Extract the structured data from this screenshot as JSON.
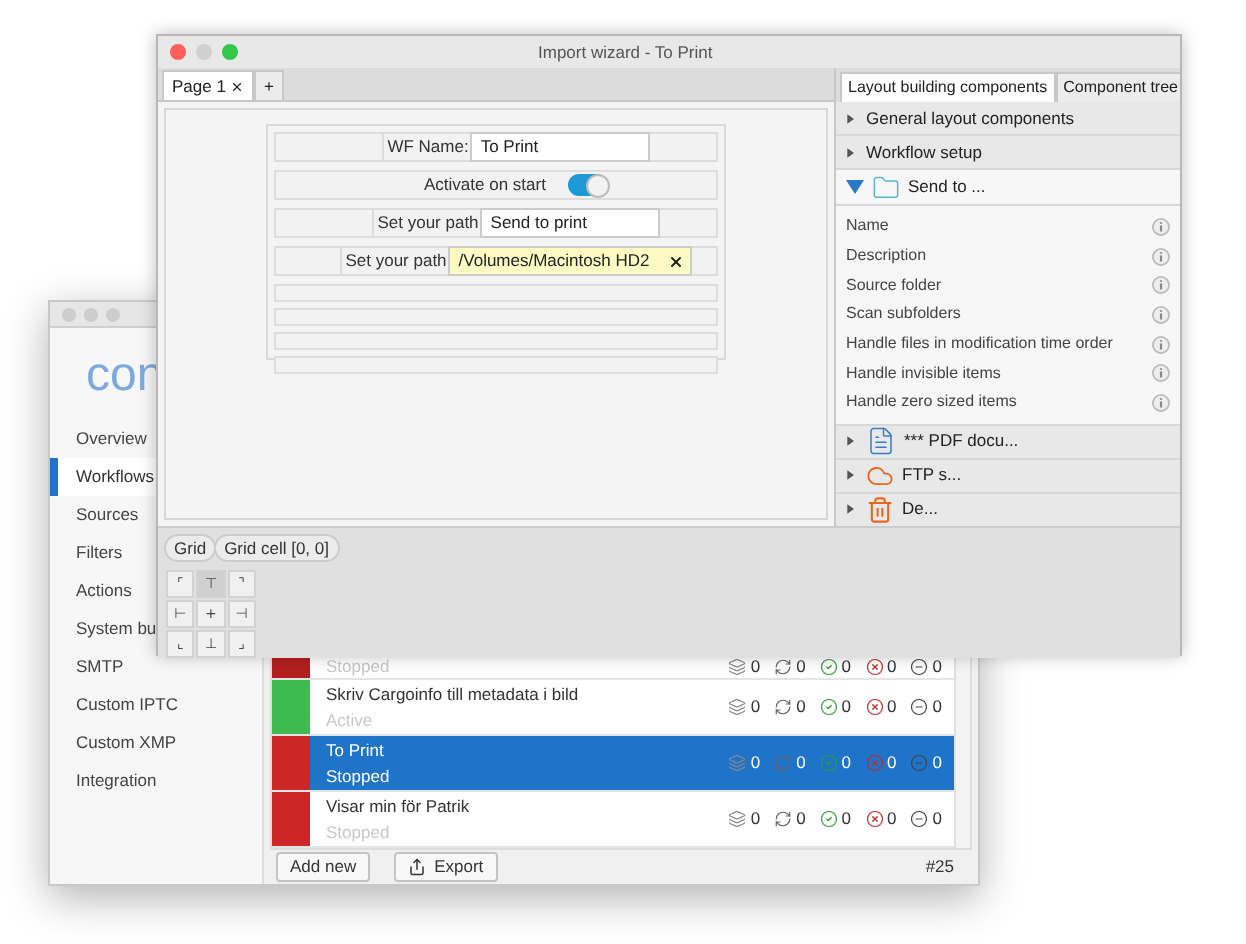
{
  "back_window": {
    "logo": "con",
    "sidebar": {
      "items": [
        {
          "label": "Overview",
          "selected": false
        },
        {
          "label": "Workflows",
          "selected": true
        },
        {
          "label": "Sources",
          "selected": false
        },
        {
          "label": "Filters",
          "selected": false
        },
        {
          "label": "Actions",
          "selected": false
        },
        {
          "label": "System bu",
          "selected": false
        },
        {
          "label": "SMTP",
          "selected": false
        },
        {
          "label": "Custom IPTC",
          "selected": false
        },
        {
          "label": "Custom XMP",
          "selected": false
        },
        {
          "label": "Integration",
          "selected": false
        }
      ]
    },
    "workflows": [
      {
        "status": "Stopped",
        "color": "#b42020",
        "selected": false,
        "counts": [
          "0",
          "0",
          "0",
          "0",
          "0"
        ]
      },
      {
        "name": "Skriv Cargoinfo till metadata i bild",
        "status": "Active",
        "color": "#3fba4f",
        "selected": false,
        "counts": [
          "0",
          "0",
          "0",
          "0",
          "0"
        ]
      },
      {
        "name": "To Print",
        "status": "Stopped",
        "color": "#cc2626",
        "selected": true,
        "counts": [
          "0",
          "0",
          "0",
          "0",
          "0"
        ]
      },
      {
        "name": "Visar min för Patrik",
        "status": "Stopped",
        "color": "#cc2626",
        "selected": false,
        "counts": [
          "0",
          "0",
          "0",
          "0",
          "0"
        ]
      }
    ],
    "buttons": [
      {
        "label": "Add new",
        "kind": "plain"
      },
      {
        "label": "Export",
        "kind": "export"
      }
    ],
    "total": "#25"
  },
  "wizard": {
    "title": "Import wizard - To Print",
    "tabs": [
      {
        "label": "Page 1",
        "closable": true,
        "selected": true
      },
      {
        "label": "+",
        "closable": false,
        "selected": false
      }
    ],
    "form": [
      {
        "kind": "field",
        "label": "WF Name:",
        "value": "To Print"
      },
      {
        "kind": "toggle",
        "label": "Activate on start",
        "on": true
      },
      {
        "kind": "field",
        "label": "Set your path",
        "value": "Send to print"
      },
      {
        "kind": "path",
        "label": "Set your path",
        "value": "/Volumes/Macintosh HD2"
      },
      {
        "kind": "empty"
      },
      {
        "kind": "empty"
      },
      {
        "kind": "empty"
      },
      {
        "kind": "empty"
      }
    ],
    "breadcrumb": [
      "Grid",
      "Grid cell [0, 0]"
    ],
    "alignment": [
      {
        "glyph": "⌜",
        "selected": false
      },
      {
        "glyph": "⊤",
        "selected": true
      },
      {
        "glyph": "⌝",
        "selected": false
      },
      {
        "glyph": "⊢",
        "selected": false
      },
      {
        "glyph": "+",
        "selected": false
      },
      {
        "glyph": "⊣",
        "selected": false
      },
      {
        "glyph": "⌞",
        "selected": false
      },
      {
        "glyph": "⊥",
        "selected": false
      },
      {
        "glyph": "⌟",
        "selected": false
      }
    ],
    "panel": {
      "tabs": [
        {
          "label": "Layout building components",
          "selected": true
        },
        {
          "label": "Component tree",
          "selected": false
        }
      ],
      "sections": [
        {
          "label": "General layout components",
          "kind": "group",
          "expanded": false
        },
        {
          "label": "Workflow setup",
          "kind": "group",
          "expanded": false
        },
        {
          "label": "Send to ...",
          "kind": "folder",
          "expanded": true,
          "items": [
            "Name",
            "Description",
            "Source folder",
            "Scan subfolders",
            "Handle files in modification time order",
            "Handle invisible items",
            "Handle zero sized items"
          ]
        },
        {
          "label": "*** PDF docu...",
          "kind": "document",
          "expanded": false
        },
        {
          "label": "FTP s...",
          "kind": "cloud",
          "expanded": false
        },
        {
          "label": "De...",
          "kind": "trash",
          "expanded": false
        }
      ]
    }
  }
}
